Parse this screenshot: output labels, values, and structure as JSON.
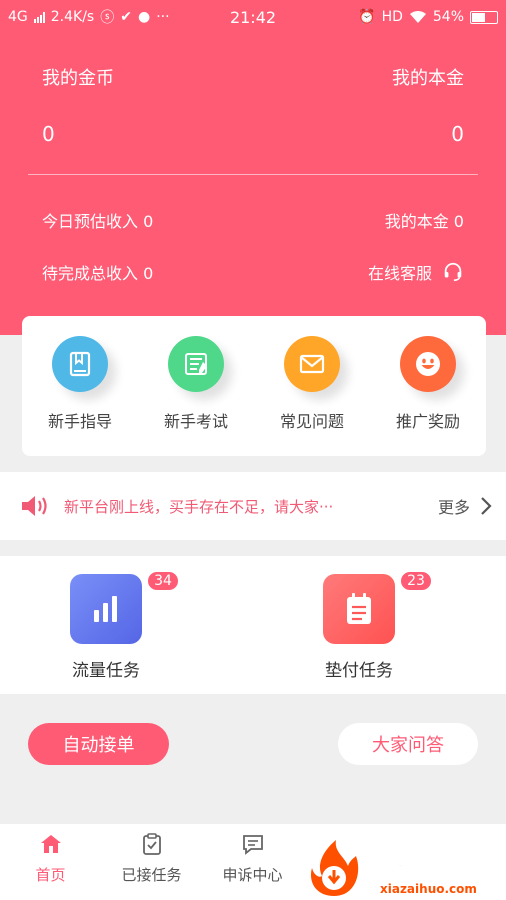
{
  "status_bar": {
    "network": "4G",
    "speed": "2.4K/s",
    "time": "21:42",
    "hd": "HD",
    "battery": "54%"
  },
  "header": {
    "coins_label": "我的金币",
    "coins_value": "0",
    "principal_label": "我的本金",
    "principal_value": "0",
    "today_income": "今日预估收入 0",
    "my_principal": "我的本金 0",
    "pending_income": "待完成总收入 0",
    "online_service": "在线客服"
  },
  "quick_links": [
    {
      "label": "新手指导",
      "color": "#4fb8e6",
      "icon": "book-icon"
    },
    {
      "label": "新手考试",
      "color": "#4fd88a",
      "icon": "exam-icon"
    },
    {
      "label": "常见问题",
      "color": "#ffa629",
      "icon": "mail-icon"
    },
    {
      "label": "推广奖励",
      "color": "#ff6a3d",
      "icon": "smile-icon"
    }
  ],
  "notice": {
    "text": "新平台刚上线，买手存在不足，请大家···",
    "more": "更多"
  },
  "tasks": [
    {
      "label": "流量任务",
      "badge": "34",
      "color": "#6a7ef2",
      "icon": "chart-icon"
    },
    {
      "label": "垫付任务",
      "badge": "23",
      "color": "#ff6464",
      "icon": "clipboard-icon"
    }
  ],
  "actions": {
    "auto_accept": "自动接单",
    "qa": "大家问答"
  },
  "tabbar": [
    {
      "label": "首页",
      "icon": "home-icon",
      "active": true
    },
    {
      "label": "已接任务",
      "icon": "task-check-icon",
      "active": false
    },
    {
      "label": "申诉中心",
      "icon": "chat-icon",
      "active": false
    }
  ],
  "watermark": {
    "brand": "下载火",
    "site": "xiazaihuo.com"
  },
  "colors": {
    "primary": "#ff5b75",
    "background": "#efefef"
  }
}
